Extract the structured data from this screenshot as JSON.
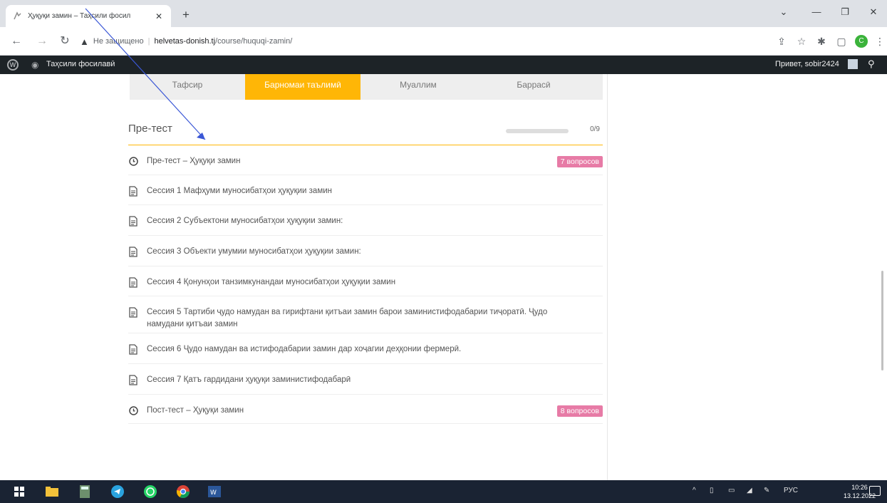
{
  "browser": {
    "tab_title": "Ҳуқуқи замин – Таҳсили фосил",
    "url_security": "Не защищено",
    "url_host": "helvetas-donish.tj",
    "url_path": "/course/huquqi-zamin/",
    "profile_initial": "C"
  },
  "adminbar": {
    "site_name": "Таҳсили фосилавӣ",
    "greeting": "Привет, sobir2424"
  },
  "course_tabs": [
    {
      "label": "Тафсир"
    },
    {
      "label": "Барномаи таълимӣ"
    },
    {
      "label": "Муаллим"
    },
    {
      "label": "Баррасӣ"
    }
  ],
  "section": {
    "title": "Пре-тест",
    "progress_done": 0,
    "progress_total": 9,
    "progress_label": "0/9"
  },
  "lessons": [
    {
      "type": "quiz",
      "title": "Пре-тест – Ҳуқуқи замин",
      "badge": "7 вопросов"
    },
    {
      "type": "lesson",
      "title": "Сессия 1 Мафҳуми муносибатҳои ҳуқуқии замин"
    },
    {
      "type": "lesson",
      "title": "Сессия 2 Субъектони муносибатҳои ҳуқуқии замин:"
    },
    {
      "type": "lesson",
      "title": "Сессия 3 Объекти умумии муносибатҳои ҳуқуқии замин:"
    },
    {
      "type": "lesson",
      "title": "Сессия 4 Қонунҳои танзимкунандаи муносибатҳои ҳуқуқии замин"
    },
    {
      "type": "lesson",
      "title": "Сессия 5 Тартиби ҷудо намудан ва гирифтани қитъаи замин барои заминистифодабарии тиҷоратӣ. Ҷудо намудани қитъаи замин"
    },
    {
      "type": "lesson",
      "title": "Сессия 6 Ҷудо намудан ва истифодабарии замин дар хоҷагии деҳқонии фермерӣ."
    },
    {
      "type": "lesson",
      "title": "Сессия 7 Қатъ гардидани ҳуқуқи заминистифодабарӣ"
    },
    {
      "type": "quiz",
      "title": "Пост-тест – Ҳуқуқи замин",
      "badge": "8 вопросов"
    }
  ],
  "taskbar": {
    "lang": "РУС",
    "time": "10:26",
    "date": "13.12.2022"
  },
  "colors": {
    "accent": "#ffb606",
    "badge": "#e77ba6",
    "adminbar": "#1d2327",
    "taskbar": "#1a2333"
  }
}
